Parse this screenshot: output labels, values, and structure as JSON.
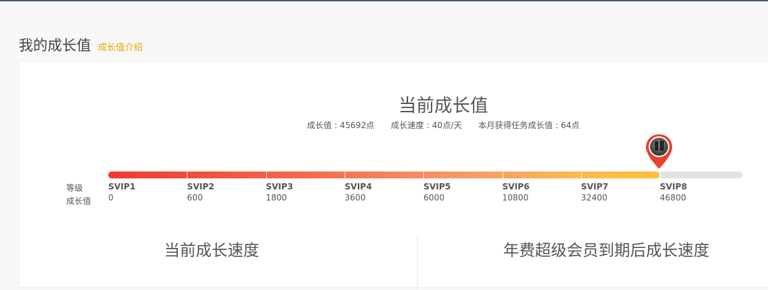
{
  "header": {
    "title": "我的成长值",
    "intro_link": "成长值介绍"
  },
  "current": {
    "title": "当前成长值",
    "stats": [
      "成长值 : 45692点",
      "成长速度 : 40点/天",
      "本月获得任务成长值 : 64点"
    ]
  },
  "progress": {
    "row_label_level": "等级",
    "row_label_value": "成长值",
    "fraction": 0.868,
    "levels": [
      {
        "name": "SVIP1",
        "value": "0"
      },
      {
        "name": "SVIP2",
        "value": "600"
      },
      {
        "name": "SVIP3",
        "value": "1800"
      },
      {
        "name": "SVIP4",
        "value": "3600"
      },
      {
        "name": "SVIP5",
        "value": "6000"
      },
      {
        "name": "SVIP6",
        "value": "10800"
      },
      {
        "name": "SVIP7",
        "value": "32400"
      },
      {
        "name": "SVIP8",
        "value": "46800"
      }
    ]
  },
  "sections": {
    "speed_title": "当前成长速度",
    "expiry_title": "年费超级会员到期后成长速度"
  },
  "colors": {
    "accent": "#e6a700",
    "marker": "#e8412f",
    "track": "#e2e2e2"
  },
  "icons": {
    "marker": "map-pin-avatar-icon"
  }
}
